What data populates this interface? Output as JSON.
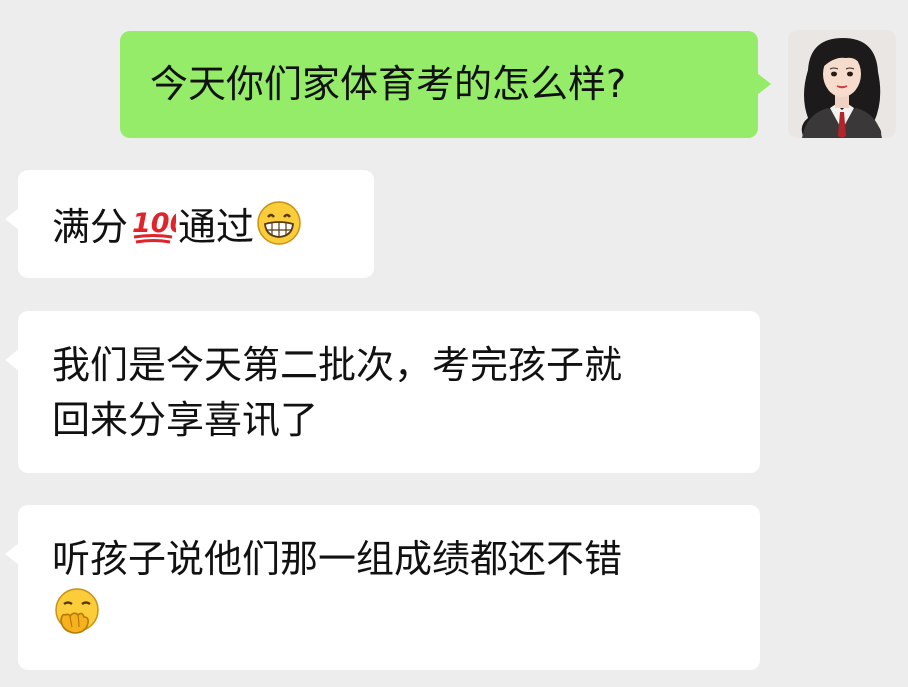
{
  "conversation": {
    "outgoing": {
      "text": "今天你们家体育考的怎么样?",
      "avatar_icon": "woman-portrait-avatar",
      "bubble_color": "#95ec69"
    },
    "incoming": [
      {
        "before_emoji": "满分",
        "emoji_1": "hundred-points-icon",
        "after_emoji": "通过",
        "emoji_2": "grinning-face-icon"
      },
      {
        "line_1": "我们是今天第二批次，考完孩子就",
        "line_2": "回来分享喜讯了"
      },
      {
        "line_1": "听孩子说他们那一组成绩都还不错",
        "emoji": "face-with-hand-over-mouth-icon"
      }
    ]
  },
  "colors": {
    "background": "#ededed",
    "incoming_bubble": "#ffffff",
    "text": "#111111"
  }
}
